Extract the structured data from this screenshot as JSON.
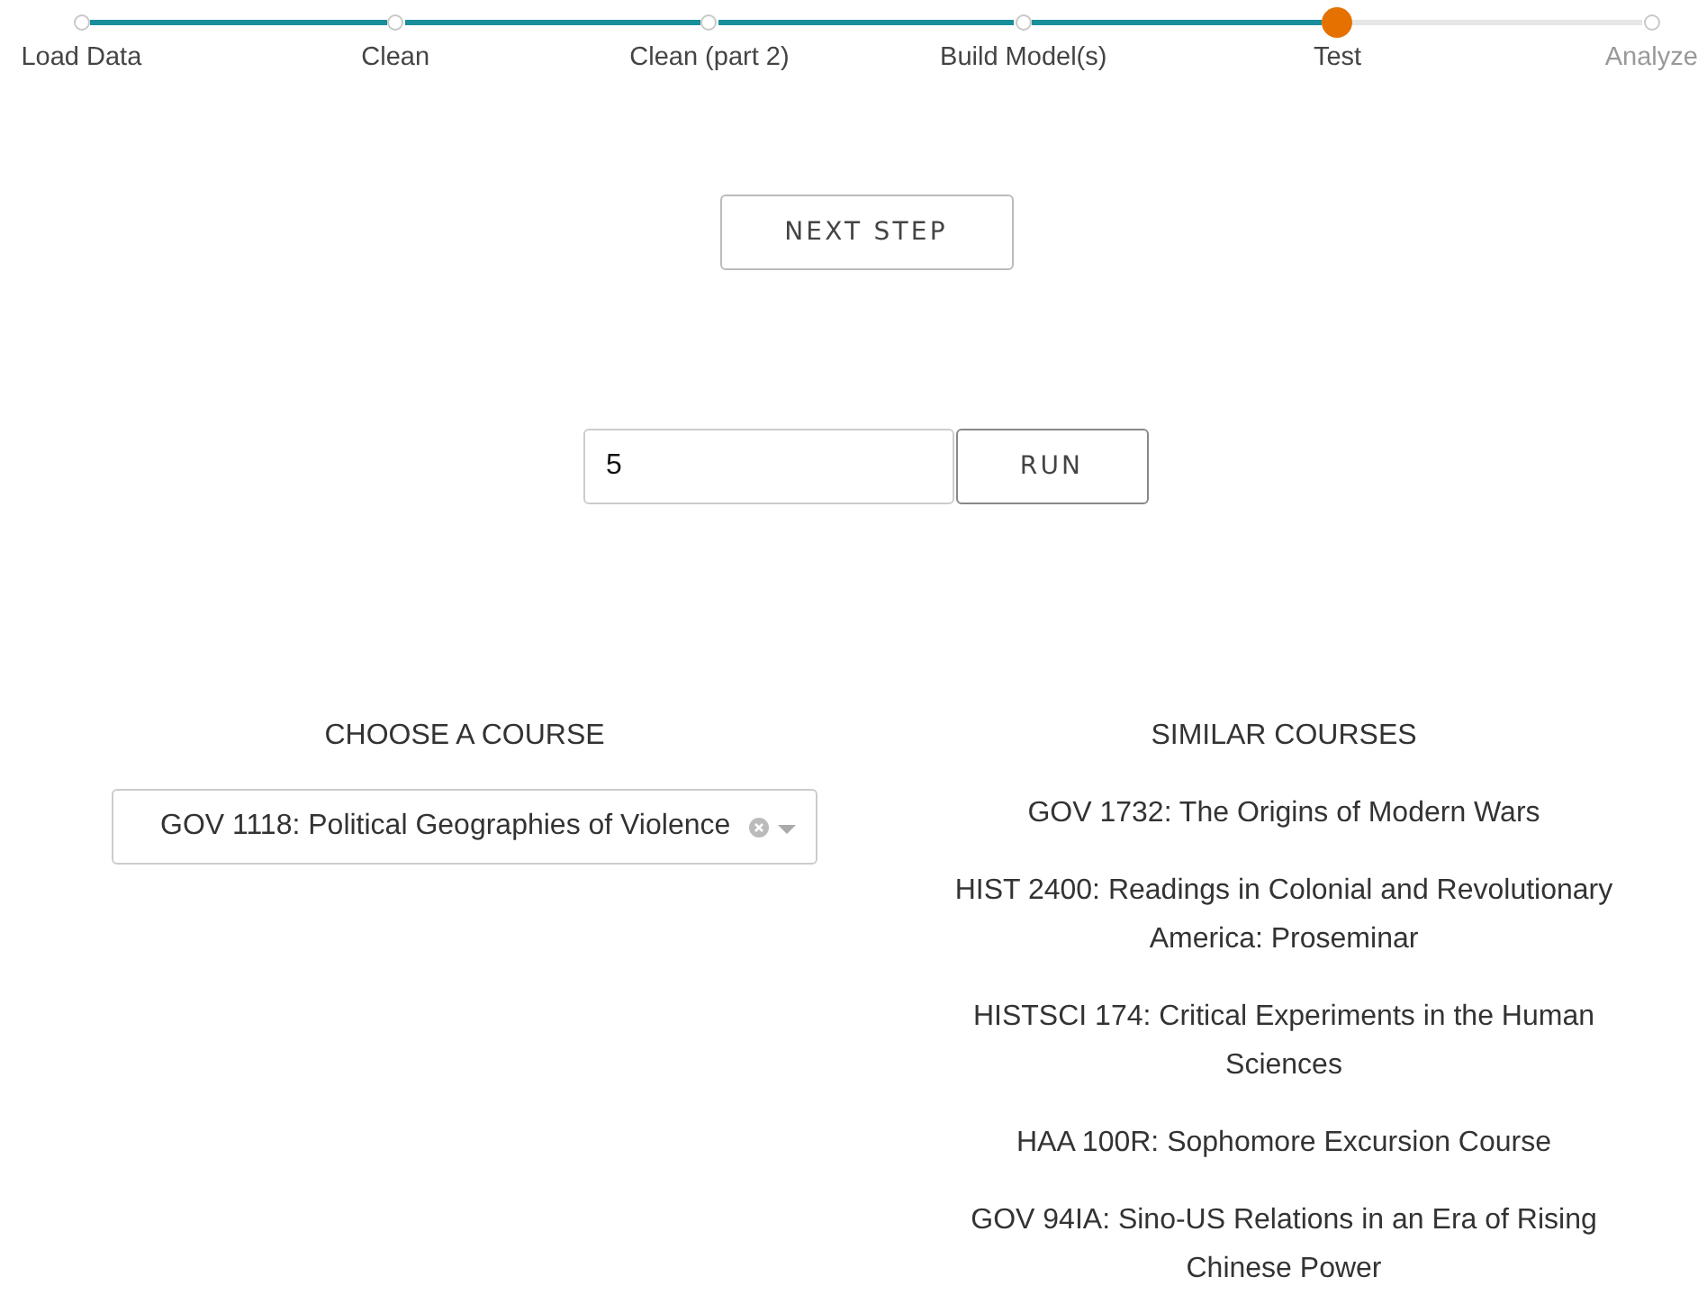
{
  "steps": [
    {
      "label": "Load Data",
      "done": true,
      "selected": false
    },
    {
      "label": "Clean",
      "done": true,
      "selected": false
    },
    {
      "label": "Clean (part 2)",
      "done": true,
      "selected": false
    },
    {
      "label": "Build Model(s)",
      "done": true,
      "selected": false
    },
    {
      "label": "Test",
      "done": false,
      "selected": true
    },
    {
      "label": "Analyze",
      "done": false,
      "selected": false
    }
  ],
  "next_button": "NEXT STEP",
  "run_form": {
    "value": "5",
    "button": "RUN"
  },
  "choose": {
    "heading": "CHOOSE A COURSE",
    "value": "GOV 1118: Political Geographies of Violence"
  },
  "similar": {
    "heading": "SIMILAR COURSES",
    "courses": [
      "GOV 1732: The Origins of Modern Wars",
      "HIST 2400: Readings in Colonial and Revolutionary America: Proseminar",
      "HISTSCI 174: Critical Experiments in the Human Sciences",
      "HAA 100R: Sophomore Excursion Course",
      "GOV 94IA: Sino-US Relations in an Era of Rising Chinese Power"
    ]
  }
}
